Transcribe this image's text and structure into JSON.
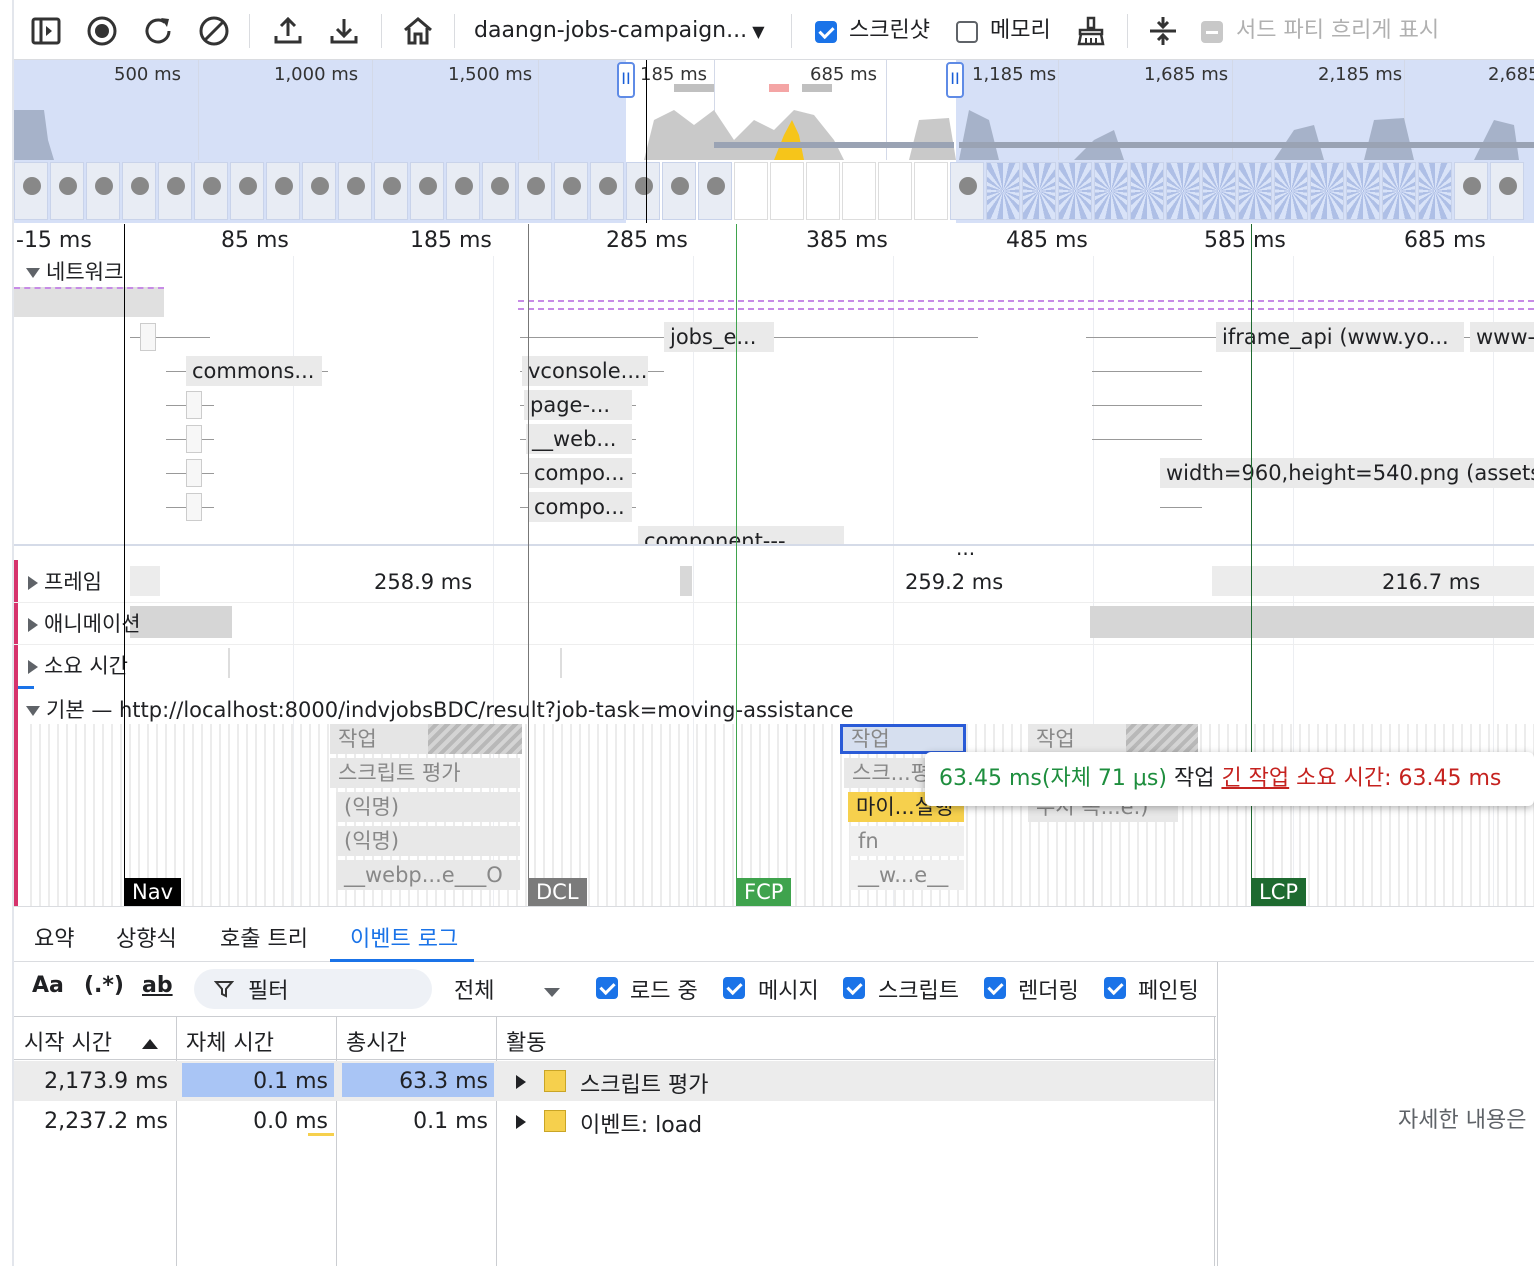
{
  "toolbar": {
    "recording_name": "daangn-jobs-campaign...",
    "screenshots_label": "스크린샷",
    "screenshots_checked": true,
    "memory_label": "메모리",
    "memory_checked": false,
    "third_party_label": "서드 파티 흐리게 표시",
    "third_party_checked": false
  },
  "overview": {
    "tick_labels": [
      "500 ms",
      "1,000 ms",
      "1,500 ms",
      "185 ms",
      "685 ms",
      "1,185 ms",
      "1,685 ms",
      "2,185 ms",
      "2,685"
    ]
  },
  "ruler": {
    "labels": [
      "-15 ms",
      "85 ms",
      "185 ms",
      "285 ms",
      "385 ms",
      "485 ms",
      "585 ms",
      "685 ms"
    ]
  },
  "network": {
    "title": "네트워크",
    "requests": [
      "jobs_e...",
      "iframe_api (www.yo...",
      "www-",
      "commons...",
      "vconsole....",
      "page-...",
      "__web...",
      "compo...",
      "compo...",
      "component---",
      "width=960,height=540.png (assets"
    ],
    "more": "..."
  },
  "tracks": {
    "frames": {
      "label": "프레임",
      "values": [
        "258.9 ms",
        "259.2 ms",
        "216.7 ms"
      ]
    },
    "animations": {
      "label": "애니메이션"
    },
    "timings": {
      "label": "소요 시간"
    },
    "main": {
      "label": "기본 — http://localhost:8000/indvjobsBDC/result?job-task=moving-assistance"
    }
  },
  "flame": {
    "task": "작업",
    "script_eval": "스크립트 평가",
    "anon1": "(익명)",
    "anon2": "(익명)",
    "webpack": "__webp...e___O",
    "task_selected": "작업",
    "script_short": "스크...평",
    "micro": "마이...실행",
    "fn": "fn",
    "w_e": "__w...e__",
    "task3": "작업",
    "trunc": "우시 목...e.)"
  },
  "markers": {
    "nav": "Nav",
    "dcl": "DCL",
    "fcp": "FCP",
    "lcp": "LCP"
  },
  "tooltip": {
    "duration": "63.45 ms(자체 71 μs)",
    "name": "작업",
    "long_task": "긴 작업",
    "long_rest": "소요 시간: 63.45 ms"
  },
  "tabs": [
    "요약",
    "상향식",
    "호출 트리",
    "이벤트 로그"
  ],
  "active_tab": "이벤트 로그",
  "filterbar": {
    "match_case": "Aa",
    "regex": "(.*)",
    "whole_word": "ab",
    "filter_placeholder": "필터",
    "duration_select": "전체",
    "checks": [
      {
        "label": "로드 중",
        "checked": true
      },
      {
        "label": "메시지",
        "checked": true
      },
      {
        "label": "스크립트",
        "checked": true
      },
      {
        "label": "렌더링",
        "checked": true
      },
      {
        "label": "페인팅",
        "checked": true
      }
    ]
  },
  "table": {
    "headers": [
      "시작 시간",
      "자체 시간",
      "총시간",
      "활동"
    ],
    "rows": [
      {
        "start": "2,173.9 ms",
        "self": "0.1 ms",
        "total": "63.3 ms",
        "activity": "스크립트 평가"
      },
      {
        "start": "2,237.2 ms",
        "self": "0.0 ms",
        "total": "0.1 ms",
        "activity": "이벤트: load"
      }
    ]
  },
  "details": {
    "placeholder": "자세한 내용은"
  },
  "colors": {
    "accent": "#1a73e8",
    "script": "#f6d04d",
    "fcp": "#3fa34d",
    "lcp": "#1e6a30",
    "dcl": "#7b7b7b",
    "nav": "#000000",
    "long_task_red": "#c5221f"
  }
}
